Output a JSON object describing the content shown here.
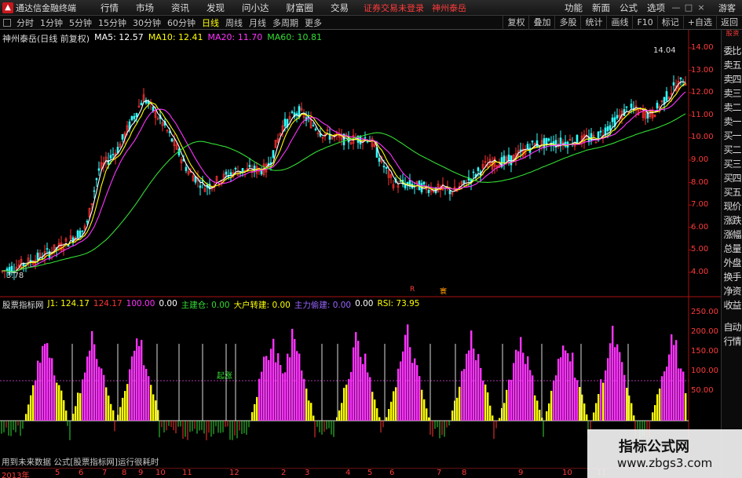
{
  "menubar": {
    "app_title": "通达信金融终端",
    "items": [
      "行情",
      "市场",
      "资讯",
      "发现",
      "问小达",
      "财富圈",
      "交易"
    ],
    "status_text": "证券交易未登录",
    "stock_name": "神州泰岳",
    "right_items": [
      "功能",
      "新面",
      "公式",
      "选项"
    ],
    "window_buttons": [
      "—",
      "□",
      "×"
    ],
    "guest": "游客"
  },
  "toolbar": {
    "periods": [
      "分时",
      "1分钟",
      "5分钟",
      "15分钟",
      "30分钟",
      "60分钟",
      "日线",
      "周线",
      "月线",
      "多周期",
      "更多"
    ],
    "active_period": "日线",
    "right_buttons": [
      "复权",
      "叠加",
      "多股",
      "统计",
      "画线",
      "F10",
      "标记",
      "+自选",
      "返回"
    ]
  },
  "legend": {
    "stock": "神州泰岳(日线 前复权)",
    "ma5": "MA5: 12.57",
    "ma10": "MA10: 12.41",
    "ma20": "MA20: 11.70",
    "ma60": "MA60: 10.81"
  },
  "price_axis": [
    "14.00",
    "13.00",
    "12.00",
    "11.00",
    "10.00",
    "9.00",
    "8.00",
    "7.00",
    "6.00",
    "5.00",
    "4.00"
  ],
  "high_tag": "14.04",
  "low_tag": "3.78",
  "indicator": {
    "name": "股票指标网",
    "j1": "J1: 124.17",
    "v1": "124.17",
    "v2": "100.00",
    "v3": "0.00",
    "zhuliwei": "主建仓: 0.00",
    "dahu": "大户转建: 0.00",
    "zhuli_jiancang": "主力偷建: 0.00",
    "v4": "0.00",
    "rsi": "RSI: 73.95",
    "axis": [
      "250.00",
      "200.00",
      "150.00",
      "100.00",
      "50.00"
    ],
    "signal_tag": "起涨"
  },
  "bottom_note": "用到未来数据  公式[股票指标网]运行很耗时",
  "dates": [
    "2013年",
    "5",
    "6",
    "7",
    "8",
    "9",
    "10",
    "11",
    "12",
    "2",
    "3",
    "4",
    "5",
    "6",
    "7",
    "8",
    "9",
    "10",
    "11"
  ],
  "flags": {
    "f1": "R",
    "f2": "寰"
  },
  "sidetabs": [
    "委比",
    "卖五",
    "卖四",
    "卖三",
    "卖二",
    "卖一",
    "买一",
    "买二",
    "买三",
    "买四",
    "买五",
    "现价",
    "涨跌",
    "涨幅",
    "总量",
    "外盘",
    "换手",
    "净资",
    "收益",
    "自动",
    "行情"
  ],
  "sidetab_top": "股 资",
  "watermark": {
    "title": "指标公式网",
    "url": "www.zbgs3.com"
  },
  "colors": {
    "up": "#ff3333",
    "down": "#33dd33",
    "ma5": "#ffffff",
    "ma10": "#ffff00",
    "ma20": "#ff33ff",
    "ma60": "#33dd33"
  }
}
